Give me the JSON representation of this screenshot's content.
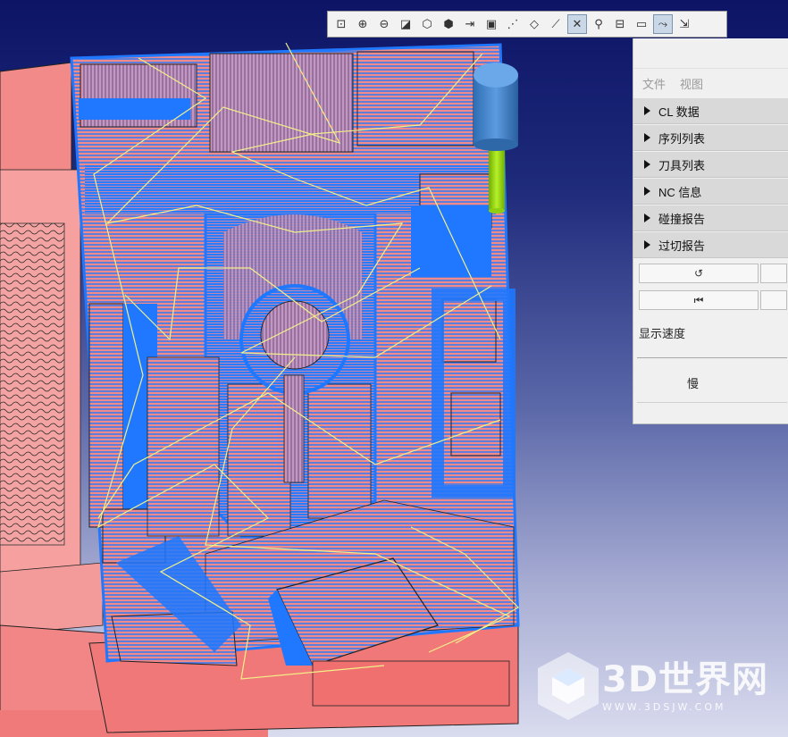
{
  "toolbar": {
    "buttons": [
      {
        "icon": "zoom-fit-icon",
        "glyph": "⊡",
        "active": false
      },
      {
        "icon": "zoom-in-icon",
        "glyph": "⊕",
        "active": false
      },
      {
        "icon": "zoom-out-icon",
        "glyph": "⊖",
        "active": false
      },
      {
        "icon": "view-front-icon",
        "glyph": "◪",
        "active": false
      },
      {
        "icon": "view-iso-icon",
        "glyph": "⬡",
        "active": false
      },
      {
        "icon": "shaded-view-icon",
        "glyph": "⬢",
        "active": false
      },
      {
        "icon": "tool-display-icon",
        "glyph": "⇥",
        "active": false
      },
      {
        "icon": "snapshot-icon",
        "glyph": "▣",
        "active": false
      },
      {
        "icon": "toolpath-points-icon",
        "glyph": "⋰",
        "active": false
      },
      {
        "icon": "section-icon",
        "glyph": "◇",
        "active": false
      },
      {
        "icon": "axis-icon",
        "glyph": "⟋",
        "active": false
      },
      {
        "icon": "hide-icon",
        "glyph": "✕",
        "active": true
      },
      {
        "icon": "tool-holder-icon",
        "glyph": "⚲",
        "active": false
      },
      {
        "icon": "settings-view-icon",
        "glyph": "⊟",
        "active": false
      },
      {
        "icon": "transparent-icon",
        "glyph": "▭",
        "active": false
      },
      {
        "icon": "path-trace-icon",
        "glyph": "⤳",
        "active": true
      },
      {
        "icon": "export-icon",
        "glyph": "⇲",
        "active": false
      }
    ]
  },
  "panel": {
    "menu": [
      "文件",
      "视图"
    ],
    "sections": [
      "CL 数据",
      "序列列表",
      "刀具列表",
      "NC 信息",
      "碰撞报告",
      "过切报告"
    ],
    "controls": {
      "reset_glyph": "↺",
      "rewind_glyph": "⏮"
    },
    "speed_label": "显示速度",
    "speed_slow": "慢"
  },
  "watermark": {
    "brand": "3D世界网",
    "url": "WWW.3DSJW.COM"
  },
  "colors": {
    "part": "#f28a8a",
    "part_edge": "#222222",
    "toolpath": "#1f78ff",
    "rapid_moves": "#f2f08a",
    "tool_body": "#3a7cc2",
    "tool_shank": "#8fd400"
  }
}
